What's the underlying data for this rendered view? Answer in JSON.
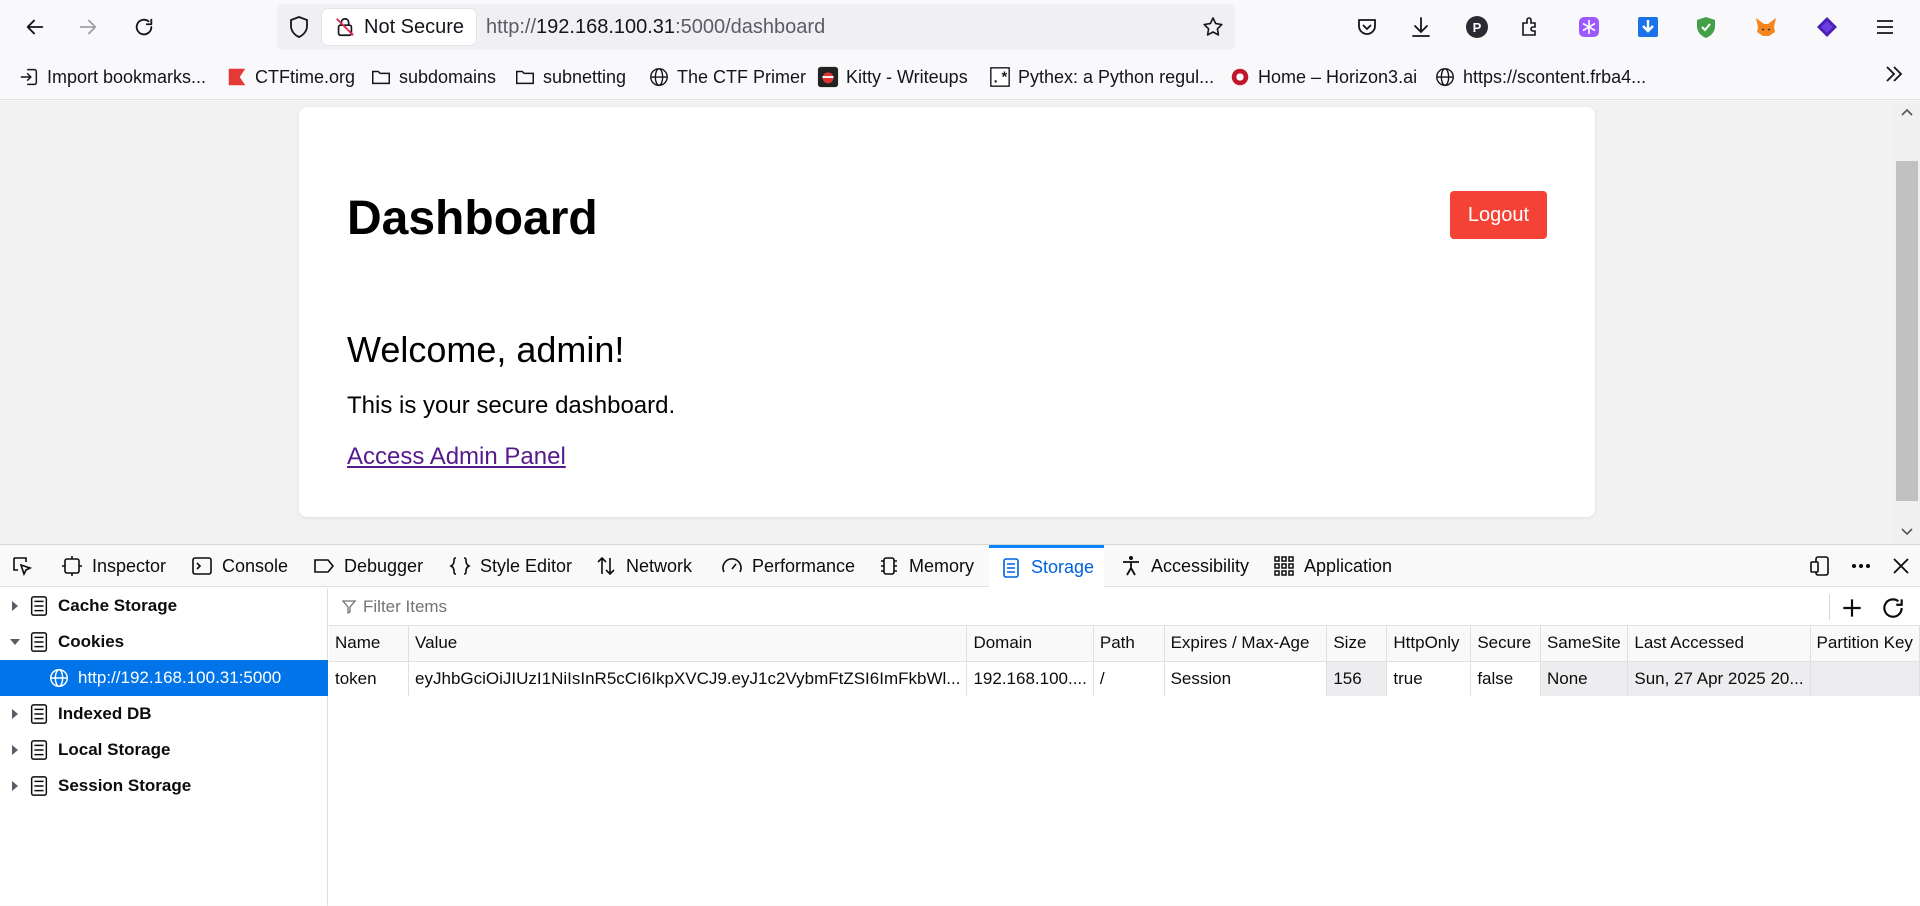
{
  "browser": {
    "security_label": "Not Secure",
    "url_prefix": "http://",
    "url_host": "192.168.100.31",
    "url_rest": ":5000/dashboard"
  },
  "bookmarks": [
    {
      "label": "Import bookmarks...",
      "icon": "import-icon"
    },
    {
      "label": "CTFtime.org",
      "icon": "ctftime-flag-icon"
    },
    {
      "label": "subdomains",
      "icon": "folder-icon"
    },
    {
      "label": "subnetting",
      "icon": "folder-icon"
    },
    {
      "label": "The CTF Primer",
      "icon": "globe-icon"
    },
    {
      "label": "Kitty - Writeups",
      "icon": "kitty-icon"
    },
    {
      "label": "Pythex: a Python regul...",
      "icon": "pythex-icon"
    },
    {
      "label": "Home – Horizon3.ai",
      "icon": "horizon3-icon"
    },
    {
      "label": "https://scontent.frba4...",
      "icon": "globe-icon"
    }
  ],
  "page": {
    "title": "Dashboard",
    "logout_label": "Logout",
    "welcome": "Welcome, admin!",
    "description": "This is your secure dashboard.",
    "admin_link": "Access Admin Panel",
    "logout_color": "#f44336"
  },
  "devtools": {
    "tabs": [
      "Inspector",
      "Console",
      "Debugger",
      "Style Editor",
      "Network",
      "Performance",
      "Memory",
      "Storage",
      "Accessibility",
      "Application"
    ],
    "active_tab": "Storage",
    "tree": {
      "cache_storage": "Cache Storage",
      "cookies": "Cookies",
      "cookie_host": "http://192.168.100.31:5000",
      "indexed_db": "Indexed DB",
      "local_storage": "Local Storage",
      "session_storage": "Session Storage"
    },
    "filter_placeholder": "Filter Items",
    "columns": [
      "Name",
      "Value",
      "Domain",
      "Path",
      "Expires / Max-Age",
      "Size",
      "HttpOnly",
      "Secure",
      "SameSite",
      "Last Accessed",
      "Partition Key"
    ],
    "rows": [
      [
        "token",
        "eyJhbGciOiJIUzI1NiIsInR5cCI6IkpXVCJ9.eyJ1c2VybmFtZSI6ImFkbWl...",
        "192.168.100....",
        "/",
        "Session",
        "156",
        "true",
        "false",
        "None",
        "Sun, 27 Apr 2025 20...",
        ""
      ]
    ]
  }
}
